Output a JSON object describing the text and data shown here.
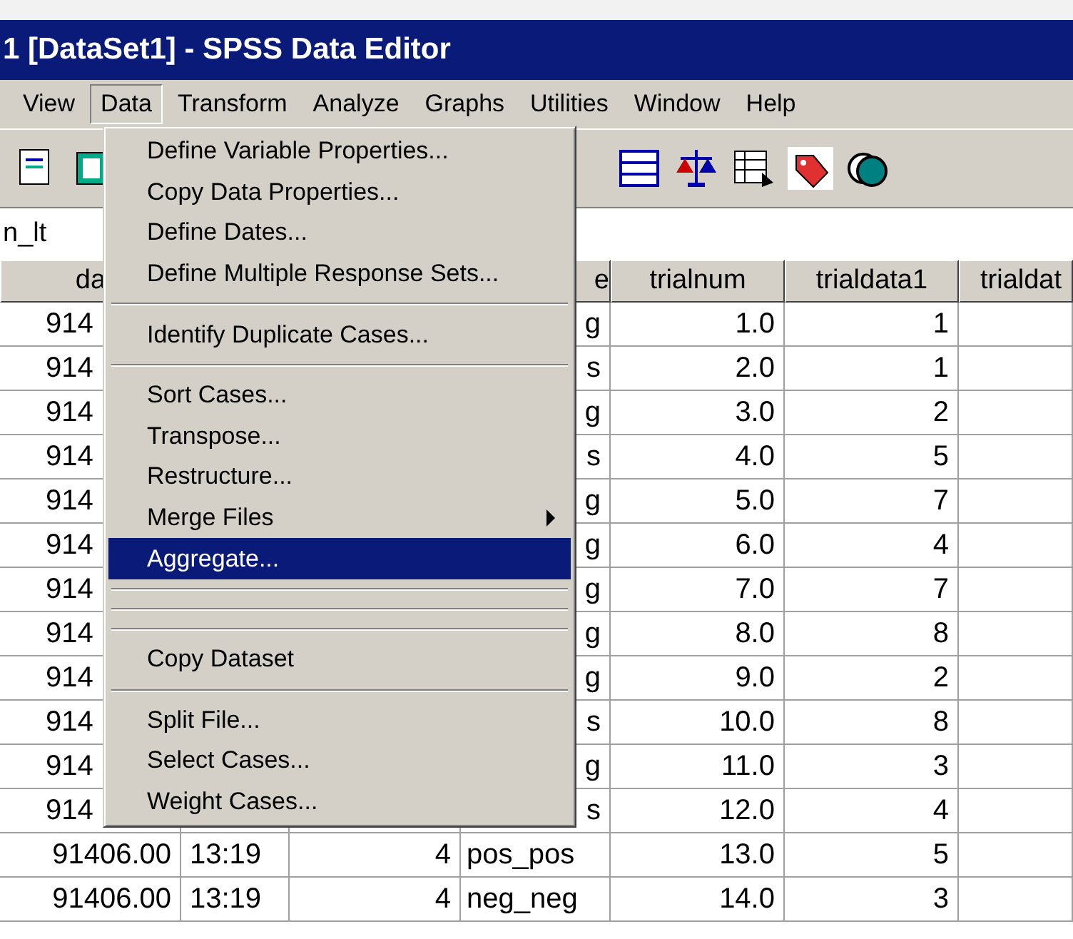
{
  "window": {
    "title": "1 [DataSet1] - SPSS Data Editor"
  },
  "menu_bar": [
    {
      "label": "View",
      "selected": false
    },
    {
      "label": "Data",
      "selected": true
    },
    {
      "label": "Transform",
      "selected": false
    },
    {
      "label": "Analyze",
      "selected": false
    },
    {
      "label": "Graphs",
      "selected": false
    },
    {
      "label": "Utilities",
      "selected": false
    },
    {
      "label": "Window",
      "selected": false
    },
    {
      "label": "Help",
      "selected": false
    }
  ],
  "cell_editor": {
    "label": "n_lt"
  },
  "table": {
    "columns": [
      "da",
      "e",
      "trialnum",
      "trialdata1",
      "trialdat"
    ],
    "rows": [
      {
        "column_1": "914",
        "column_4": "g",
        "trialnum": "1.0",
        "trialdata1": "1"
      },
      {
        "column_1": "914",
        "column_4": "s",
        "trialnum": "2.0",
        "trialdata1": "1"
      },
      {
        "column_1": "914",
        "column_4": "g",
        "trialnum": "3.0",
        "trialdata1": "2"
      },
      {
        "column_1": "914",
        "column_4": "s",
        "trialnum": "4.0",
        "trialdata1": "5"
      },
      {
        "column_1": "914",
        "column_4": "g",
        "trialnum": "5.0",
        "trialdata1": "7"
      },
      {
        "column_1": "914",
        "column_4": "g",
        "trialnum": "6.0",
        "trialdata1": "4"
      },
      {
        "column_1": "914",
        "column_4": "g",
        "trialnum": "7.0",
        "trialdata1": "7"
      },
      {
        "column_1": "914",
        "column_4": "g",
        "trialnum": "8.0",
        "trialdata1": "8"
      },
      {
        "column_1": "914",
        "column_4": "g",
        "trialnum": "9.0",
        "trialdata1": "2"
      },
      {
        "column_1": "914",
        "column_4": "s",
        "trialnum": "10.0",
        "trialdata1": "8"
      },
      {
        "column_1": "914",
        "column_4": "g",
        "trialnum": "11.0",
        "trialdata1": "3"
      },
      {
        "column_1": "914",
        "column_4": "s",
        "trialnum": "12.0",
        "trialdata1": "4"
      },
      {
        "column_1": "91406.00",
        "column_2": "13:19",
        "column_3": "4",
        "column_4": "pos_pos",
        "trialnum": "13.0",
        "trialdata1": "5"
      },
      {
        "column_1": "91406.00",
        "column_2": "13:19",
        "column_3": "4",
        "column_4": "neg_neg",
        "trialnum": "14.0",
        "trialdata1": "3"
      }
    ]
  },
  "data_menu": [
    {
      "kind": "item",
      "label": "Define Variable Properties...",
      "selected": false
    },
    {
      "kind": "item",
      "label": "Copy Data Properties...",
      "selected": false
    },
    {
      "kind": "item",
      "label": "Define Dates...",
      "selected": false
    },
    {
      "kind": "item",
      "label": "Define Multiple Response Sets...",
      "selected": false
    },
    {
      "kind": "separator"
    },
    {
      "kind": "item",
      "label": "Identify Duplicate Cases...",
      "selected": false
    },
    {
      "kind": "separator"
    },
    {
      "kind": "item",
      "label": "Sort Cases...",
      "selected": false
    },
    {
      "kind": "item",
      "label": "Transpose...",
      "selected": false
    },
    {
      "kind": "item",
      "label": "Restructure...",
      "selected": false
    },
    {
      "kind": "submenu",
      "label": "Merge Files",
      "selected": false
    },
    {
      "kind": "item",
      "label": "Aggregate...",
      "selected": true
    },
    {
      "kind": "separator"
    },
    {
      "kind": "separator"
    },
    {
      "kind": "separator"
    },
    {
      "kind": "item",
      "label": "Copy Dataset",
      "selected": false
    },
    {
      "kind": "separator"
    },
    {
      "kind": "item",
      "label": "Split File...",
      "selected": false
    },
    {
      "kind": "item",
      "label": "Select Cases...",
      "selected": false
    },
    {
      "kind": "item",
      "label": "Weight Cases...",
      "selected": false
    }
  ]
}
